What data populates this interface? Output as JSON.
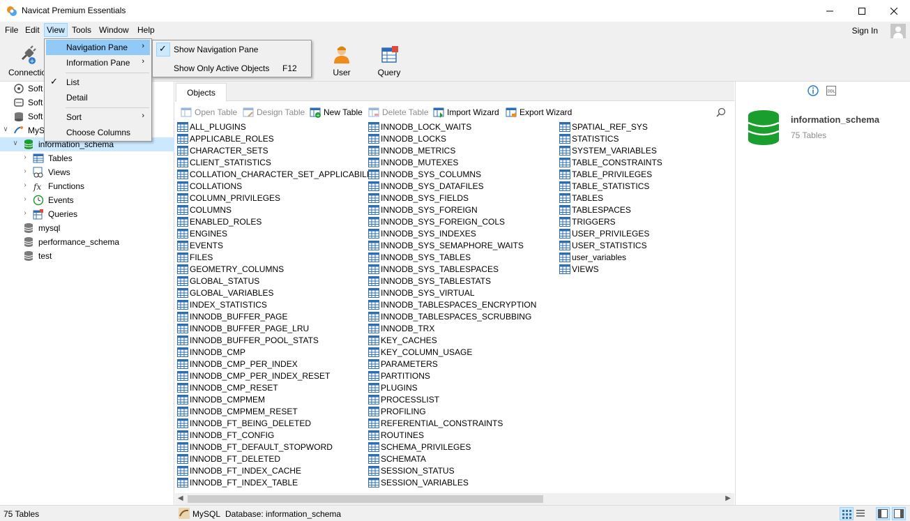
{
  "window": {
    "title": "Navicat Premium Essentials"
  },
  "menubar": {
    "items": [
      "File",
      "Edit",
      "View",
      "Tools",
      "Window",
      "Help"
    ],
    "signin": "Sign In"
  },
  "toolbar": {
    "connection": "Connection",
    "user": "User",
    "query": "Query"
  },
  "view_menu": {
    "items": [
      {
        "label": "Navigation Pane",
        "has_submenu": true,
        "checked": false
      },
      {
        "label": "Information Pane",
        "has_submenu": true,
        "checked": false
      },
      {
        "label": "List",
        "has_submenu": false,
        "checked": true
      },
      {
        "label": "Detail",
        "has_submenu": false,
        "checked": false
      },
      {
        "label": "Sort",
        "has_submenu": true,
        "checked": false
      },
      {
        "label": "Choose Columns",
        "has_submenu": false,
        "checked": false
      }
    ]
  },
  "nav_submenu": {
    "items": [
      {
        "label": "Show Navigation Pane",
        "shortcut": "",
        "checked": true
      },
      {
        "label": "Show Only Active Objects",
        "shortcut": "F12",
        "checked": false
      }
    ]
  },
  "navigation": {
    "connections": [
      "Soft",
      "Soft",
      "Soft",
      "MyS"
    ],
    "selected_db": "information_schema",
    "children": [
      "Tables",
      "Views",
      "Functions",
      "Events",
      "Queries"
    ],
    "other_dbs": [
      "mysql",
      "performance_schema",
      "test"
    ]
  },
  "objects": {
    "tab": "Objects",
    "toolbar": [
      "Open Table",
      "Design Table",
      "New Table",
      "Delete Table",
      "Import Wizard",
      "Export Wizard"
    ],
    "tables": [
      "ALL_PLUGINS",
      "APPLICABLE_ROLES",
      "CHARACTER_SETS",
      "CLIENT_STATISTICS",
      "COLLATION_CHARACTER_SET_APPLICABILITY",
      "COLLATIONS",
      "COLUMN_PRIVILEGES",
      "COLUMNS",
      "ENABLED_ROLES",
      "ENGINES",
      "EVENTS",
      "FILES",
      "GEOMETRY_COLUMNS",
      "GLOBAL_STATUS",
      "GLOBAL_VARIABLES",
      "INDEX_STATISTICS",
      "INNODB_BUFFER_PAGE",
      "INNODB_BUFFER_PAGE_LRU",
      "INNODB_BUFFER_POOL_STATS",
      "INNODB_CMP",
      "INNODB_CMP_PER_INDEX",
      "INNODB_CMP_PER_INDEX_RESET",
      "INNODB_CMP_RESET",
      "INNODB_CMPMEM",
      "INNODB_CMPMEM_RESET",
      "INNODB_FT_BEING_DELETED",
      "INNODB_FT_CONFIG",
      "INNODB_FT_DEFAULT_STOPWORD",
      "INNODB_FT_DELETED",
      "INNODB_FT_INDEX_CACHE",
      "INNODB_FT_INDEX_TABLE",
      "INNODB_LOCK_WAITS",
      "INNODB_LOCKS",
      "INNODB_METRICS",
      "INNODB_MUTEXES",
      "INNODB_SYS_COLUMNS",
      "INNODB_SYS_DATAFILES",
      "INNODB_SYS_FIELDS",
      "INNODB_SYS_FOREIGN",
      "INNODB_SYS_FOREIGN_COLS",
      "INNODB_SYS_INDEXES",
      "INNODB_SYS_SEMAPHORE_WAITS",
      "INNODB_SYS_TABLES",
      "INNODB_SYS_TABLESPACES",
      "INNODB_SYS_TABLESTATS",
      "INNODB_SYS_VIRTUAL",
      "INNODB_TABLESPACES_ENCRYPTION",
      "INNODB_TABLESPACES_SCRUBBING",
      "INNODB_TRX",
      "KEY_CACHES",
      "KEY_COLUMN_USAGE",
      "PARAMETERS",
      "PARTITIONS",
      "PLUGINS",
      "PROCESSLIST",
      "PROFILING",
      "REFERENTIAL_CONSTRAINTS",
      "ROUTINES",
      "SCHEMA_PRIVILEGES",
      "SCHEMATA",
      "SESSION_STATUS",
      "SESSION_VARIABLES",
      "SPATIAL_REF_SYS",
      "STATISTICS",
      "SYSTEM_VARIABLES",
      "TABLE_CONSTRAINTS",
      "TABLE_PRIVILEGES",
      "TABLE_STATISTICS",
      "TABLES",
      "TABLESPACES",
      "TRIGGERS",
      "USER_PRIVILEGES",
      "USER_STATISTICS",
      "user_variables",
      "VIEWS"
    ]
  },
  "info": {
    "db_name": "information_schema",
    "db_count": "75 Tables"
  },
  "status": {
    "left": "75 Tables",
    "conn": "MySQL",
    "db": "Database: information_schema"
  },
  "colors": {
    "accent": "#cce8ff",
    "menu_highlight": "#91c9f7",
    "db_green": "#1a9e2e",
    "table_blue": "#2e6db4"
  }
}
